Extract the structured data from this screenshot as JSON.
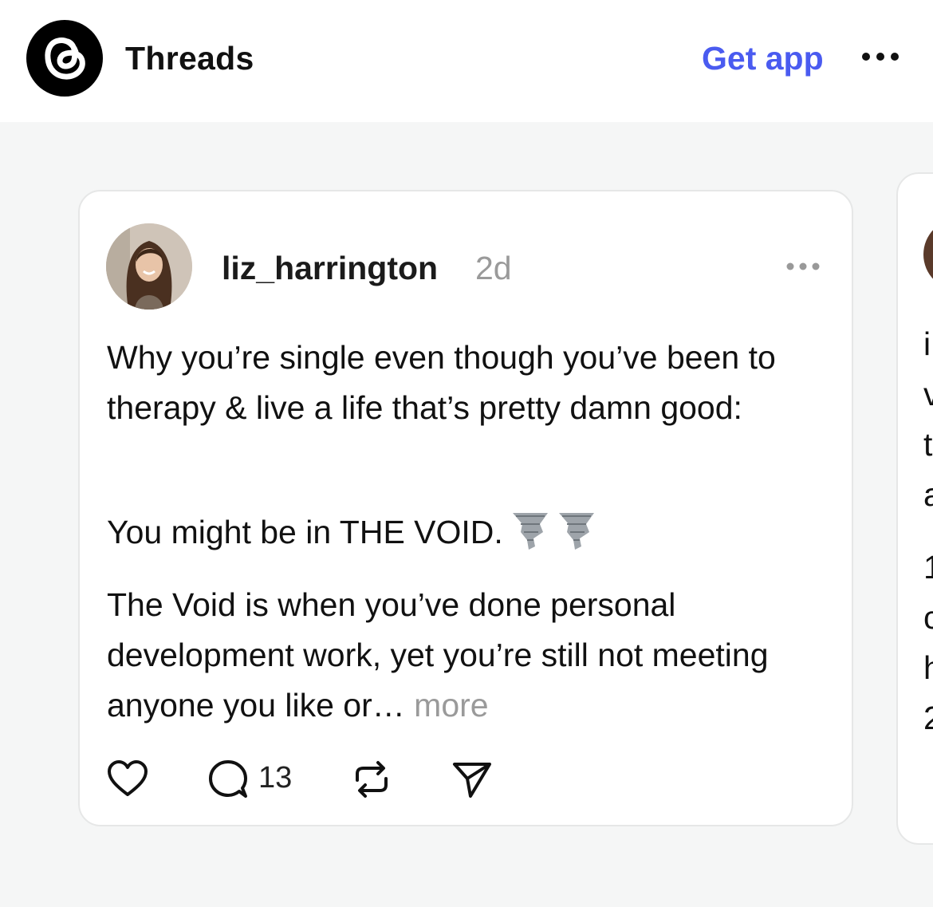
{
  "header": {
    "brand": "Threads",
    "get_app": "Get app",
    "logo_icon": "threads-logo-icon",
    "more_icon": "more-horizontal-icon"
  },
  "post": {
    "username": "liz_harrington",
    "time": "2d",
    "paragraph1": "Why you’re single even though you’ve been to therapy & live a life that’s pretty damn good:",
    "paragraph2": "You might be in THE VOID.",
    "paragraph2_emoji": "tornado-emoji",
    "paragraph3": "The Void is when you’ve done personal development work, yet you’re still not meeting anyone you like or…",
    "more_label": "more",
    "reply_count": "13",
    "icons": [
      "heart-icon",
      "comment-icon",
      "repost-icon",
      "share-icon"
    ]
  },
  "next_post_partial": {
    "lines": [
      "i",
      "v",
      "t",
      "a",
      "1",
      "c",
      "h",
      "2"
    ]
  },
  "colors": {
    "accent": "#4a5bf0",
    "background": "#f5f6f6",
    "muted_text": "#9a9a9a"
  }
}
